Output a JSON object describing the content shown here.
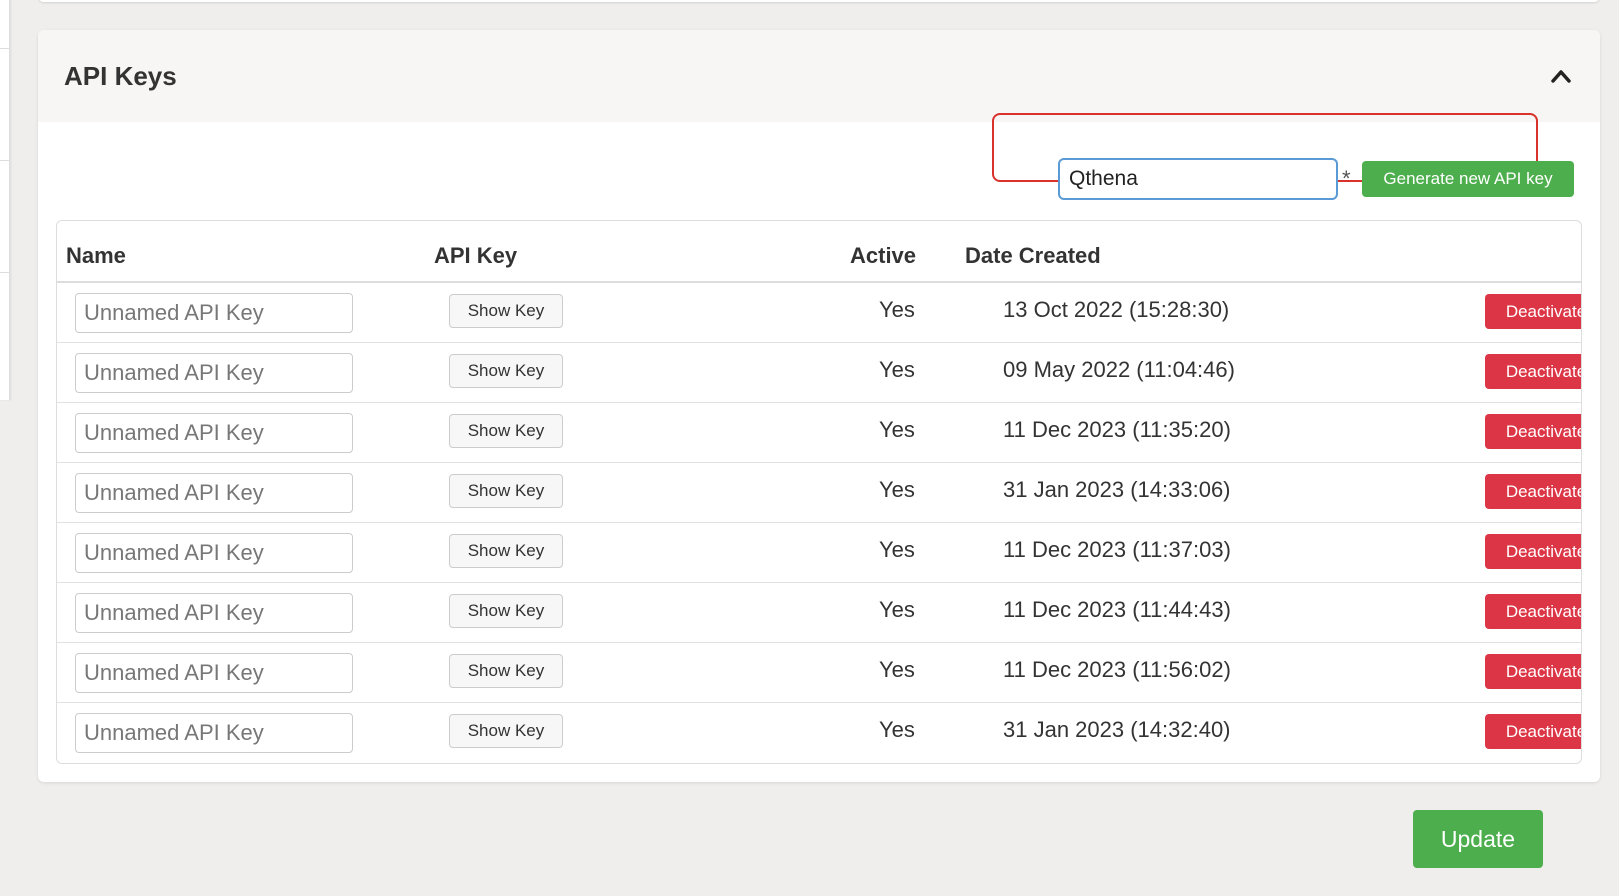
{
  "section": {
    "title": "API Keys",
    "collapse_icon": "chevron-up-icon"
  },
  "generate": {
    "input_value": "Qthena",
    "required_marker": "*",
    "button_label": "Generate new API key"
  },
  "table": {
    "headers": {
      "name": "Name",
      "api_key": "API Key",
      "active": "Active",
      "date_created": "Date Created"
    },
    "rows": [
      {
        "name_placeholder": "Unnamed API Key",
        "show_key_label": "Show Key",
        "active": "Yes",
        "date_created": "13 Oct 2022 (15:28:30)",
        "deactivate_label": "Deactivate"
      },
      {
        "name_placeholder": "Unnamed API Key",
        "show_key_label": "Show Key",
        "active": "Yes",
        "date_created": "09 May 2022 (11:04:46)",
        "deactivate_label": "Deactivate"
      },
      {
        "name_placeholder": "Unnamed API Key",
        "show_key_label": "Show Key",
        "active": "Yes",
        "date_created": "11 Dec 2023 (11:35:20)",
        "deactivate_label": "Deactivate"
      },
      {
        "name_placeholder": "Unnamed API Key",
        "show_key_label": "Show Key",
        "active": "Yes",
        "date_created": "31 Jan 2023 (14:33:06)",
        "deactivate_label": "Deactivate"
      },
      {
        "name_placeholder": "Unnamed API Key",
        "show_key_label": "Show Key",
        "active": "Yes",
        "date_created": "11 Dec 2023 (11:37:03)",
        "deactivate_label": "Deactivate"
      },
      {
        "name_placeholder": "Unnamed API Key",
        "show_key_label": "Show Key",
        "active": "Yes",
        "date_created": "11 Dec 2023 (11:44:43)",
        "deactivate_label": "Deactivate"
      },
      {
        "name_placeholder": "Unnamed API Key",
        "show_key_label": "Show Key",
        "active": "Yes",
        "date_created": "11 Dec 2023 (11:56:02)",
        "deactivate_label": "Deactivate"
      },
      {
        "name_placeholder": "Unnamed API Key",
        "show_key_label": "Show Key",
        "active": "Yes",
        "date_created": "31 Jan 2023 (14:32:40)",
        "deactivate_label": "Deactivate"
      }
    ]
  },
  "footer": {
    "update_label": "Update"
  },
  "colors": {
    "success": "#4cae4c",
    "danger": "#dc3545",
    "highlight_outline": "#d9312b",
    "focus_border": "#5b9bd5"
  }
}
